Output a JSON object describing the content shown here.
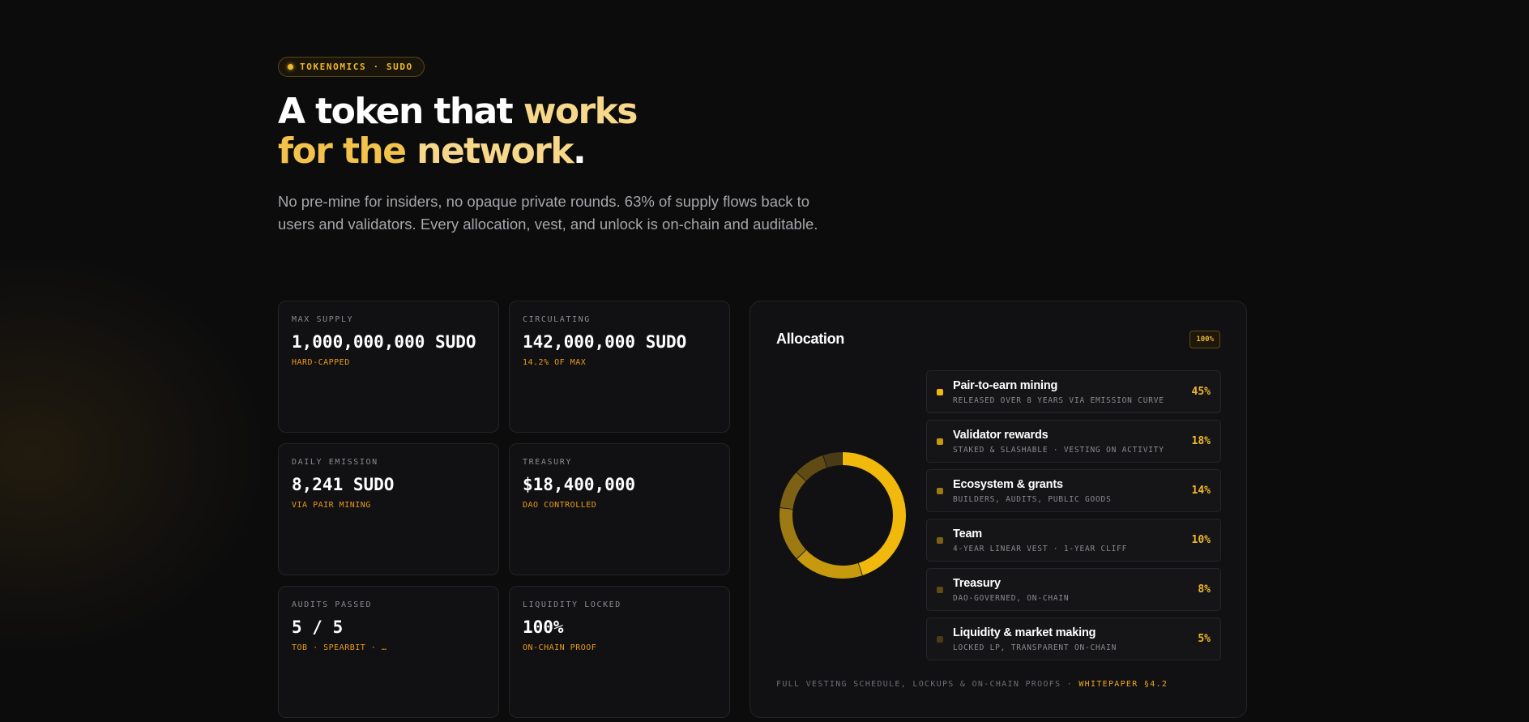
{
  "hero": {
    "badge": "TOKENOMICS · SUDO",
    "title_line1_white": "A token that ",
    "title_line1_gold": "works",
    "title_line2_gold": "for the ",
    "title_line2_light": "network",
    "title_line2_end": ".",
    "description": "No pre-mine for insiders, no opaque private rounds. 63% of supply flows back to users and validators. Every allocation, vest, and unlock is on-chain and auditable."
  },
  "stats": [
    {
      "label": "MAX SUPPLY",
      "value": "1,000,000,000 SUDO",
      "sub": "HARD-CAPPED"
    },
    {
      "label": "CIRCULATING",
      "value": "142,000,000 SUDO",
      "sub": "14.2% OF MAX"
    },
    {
      "label": "DAILY EMISSION",
      "value": "8,241 SUDO",
      "sub": "VIA PAIR MINING"
    },
    {
      "label": "TREASURY",
      "value": "$18,400,000",
      "sub": "DAO CONTROLLED"
    },
    {
      "label": "AUDITS PASSED",
      "value": "5 / 5",
      "sub": "TOB · SPEARBIT · …"
    },
    {
      "label": "LIQUIDITY LOCKED",
      "value": "100%",
      "sub": "ON-CHAIN PROOF"
    }
  ],
  "allocation": {
    "title": "Allocation",
    "total_badge": "100%",
    "items": [
      {
        "name": "Pair-to-earn mining",
        "desc": "RELEASED OVER 8 YEARS VIA EMISSION CURVE",
        "pct": "45%",
        "value": 45,
        "color": "#f0b90b"
      },
      {
        "name": "Validator rewards",
        "desc": "STAKED & SLASHABLE · VESTING ON ACTIVITY",
        "pct": "18%",
        "value": 18,
        "color": "#c6990f"
      },
      {
        "name": "Ecosystem & grants",
        "desc": "BUILDERS, AUDITS, PUBLIC GOODS",
        "pct": "14%",
        "value": 14,
        "color": "#9e7a12"
      },
      {
        "name": "Team",
        "desc": "4-YEAR LINEAR VEST · 1-YEAR CLIFF",
        "pct": "10%",
        "value": 10,
        "color": "#7d6114"
      },
      {
        "name": "Treasury",
        "desc": "DAO-GOVERNED, ON-CHAIN",
        "pct": "8%",
        "value": 8,
        "color": "#604b15"
      },
      {
        "name": "Liquidity & market making",
        "desc": "LOCKED LP, TRANSPARENT ON-CHAIN",
        "pct": "5%",
        "value": 5,
        "color": "#4a3a16"
      }
    ],
    "footnote_text": "FULL VESTING SCHEDULE, LOCKUPS & ON-CHAIN PROOFS · ",
    "footnote_link": "WHITEPAPER §4.2"
  }
}
